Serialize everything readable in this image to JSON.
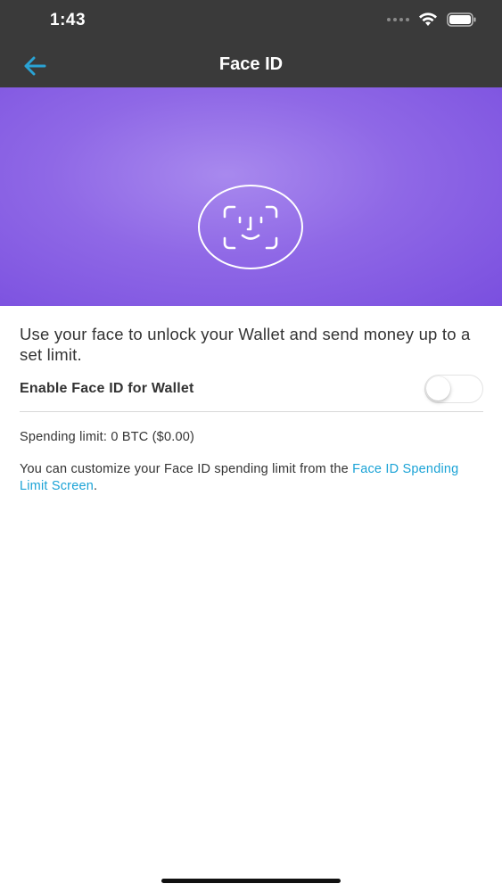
{
  "status_bar": {
    "time": "1:43"
  },
  "nav": {
    "title": "Face ID",
    "back_icon": "arrow-left-icon",
    "back_icon_color": "#2aa3d4"
  },
  "hero": {
    "icon": "face-id-icon",
    "gradient_colors": [
      "#a889ee",
      "#7a4fdf"
    ]
  },
  "main": {
    "description": "Use your face to unlock your Wallet and send money up to a set limit.",
    "toggle_label": "Enable Face ID for Wallet",
    "toggle_on": false,
    "spending_limit": "Spending limit: 0 BTC ($0.00)",
    "customize_prefix": "You can customize your Face ID spending limit from the ",
    "customize_link": "Face ID Spending Limit Screen",
    "customize_suffix": "."
  },
  "colors": {
    "link": "#1ba3d6",
    "header_bg": "#3a3a3a"
  }
}
